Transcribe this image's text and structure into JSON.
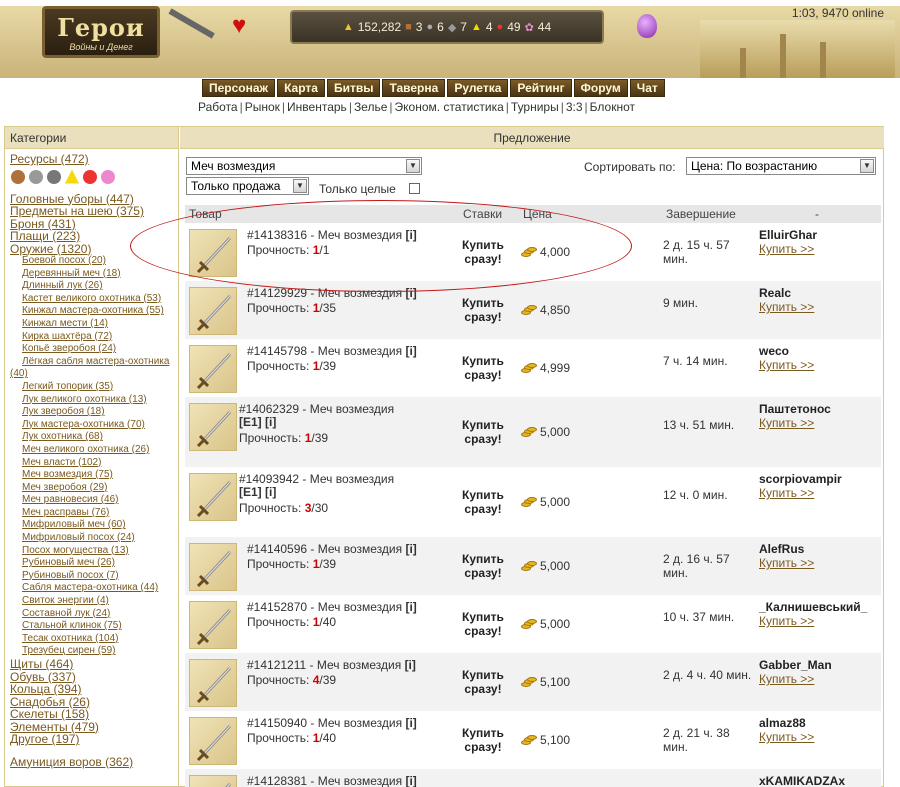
{
  "header": {
    "logo_title": "Герои",
    "logo_subtitle": "Войны и Денег",
    "time_online": "1:03, 9470 online",
    "resources": [
      {
        "icon": "gold-icon",
        "value": "152,282"
      },
      {
        "icon": "wood-icon",
        "value": "3"
      },
      {
        "icon": "ore-icon",
        "value": "6"
      },
      {
        "icon": "mercury-icon",
        "value": "7"
      },
      {
        "icon": "sulfur-icon",
        "value": "4"
      },
      {
        "icon": "crystal-icon",
        "value": "49"
      },
      {
        "icon": "gems-icon",
        "value": "44"
      }
    ],
    "nav_main": [
      "Персонаж",
      "Карта",
      "Битвы",
      "Таверна",
      "Рулетка",
      "Рейтинг",
      "Форум",
      "Чат"
    ],
    "nav_sub": [
      "Работа",
      "Рынок",
      "Инвентарь",
      "Зелье",
      "Эконом. статистика",
      "Турниры",
      "3:3",
      "Блокнот"
    ]
  },
  "left": {
    "heading": "Категории",
    "resources_link": "Ресурсы (472)",
    "categories_top": [
      "Головные уборы (447)",
      "Предметы на шею (375)",
      "Броня (431)",
      "Плащи (223)",
      "Оружие (1320)"
    ],
    "weapons": [
      "Боевой посох (20)",
      "Деревянный меч (18)",
      "Длинный лук (26)",
      "Кастет великого охотника (53)",
      "Кинжал мастера-охотника (55)",
      "Кинжал мести (14)",
      "Кирка шахтёра (72)",
      "Копьё зверобоя (24)",
      "Лёгкая сабля мастера-охотника (40)",
      "Легкий топорик (35)",
      "Лук великого охотника (13)",
      "Лук зверобоя (18)",
      "Лук мастера-охотника (70)",
      "Лук охотника (68)",
      "Меч великого охотника (26)",
      "Меч власти (102)",
      "Меч возмездия (75)",
      "Меч зверобоя (29)",
      "Меч равновесия (46)",
      "Меч расправы (76)",
      "Мифриловый меч (60)",
      "Мифриловый посох (24)",
      "Посох могущества (13)",
      "Рубиновый меч (26)",
      "Рубиновый посох (7)",
      "Сабля мастера-охотника (44)",
      "Свиток энергии (4)",
      "Составной лук (24)",
      "Стальной клинок (75)",
      "Тесак охотника (104)",
      "Трезубец сирен (59)"
    ],
    "categories_bottom": [
      "Щиты (464)",
      "Обувь (337)",
      "Кольца (394)",
      "Снадобья (26)",
      "Скелеты (158)",
      "Элементы (479)",
      "Другое (197)"
    ],
    "ammo": "Амуниция воров (362)"
  },
  "right": {
    "heading": "Предложение",
    "item_select": "Меч возмездия",
    "sale_select": "Только продажа",
    "only_whole": "Только целые",
    "sort_label": "Сортировать по:",
    "sort_select": "Цена: По возрастанию",
    "columns": {
      "item": "Товар",
      "bids": "Ставки",
      "price": "Цена",
      "ends": "Завершение",
      "seller": "-"
    },
    "buy_now": "Купить сразу!",
    "buy_link": "Купить >>",
    "lots": [
      {
        "lot": "#14138316 - Меч возмездия",
        "tag": "[i]",
        "dur_label": "Прочность:",
        "dur_cur": "1",
        "dur_max": "/1",
        "price": "4,000",
        "ends": "2 д. 15 ч. 57 мин.",
        "seller": "ElluirGhar"
      },
      {
        "lot": "#14129929 - Меч возмездия",
        "tag": "[i]",
        "dur_label": "Прочность:",
        "dur_cur": "1",
        "dur_max": "/35",
        "price": "4,850",
        "ends": "9 мин.",
        "seller": "Realc"
      },
      {
        "lot": "#14145798 - Меч возмездия",
        "tag": "[i]",
        "dur_label": "Прочность:",
        "dur_cur": "1",
        "dur_max": "/39",
        "price": "4,999",
        "ends": "7 ч. 14 мин.",
        "seller": "weco"
      },
      {
        "lot": "#14062329 - Меч возмездия",
        "tag": "[E1] [i]",
        "dur_label": "Прочность:",
        "dur_cur": "1",
        "dur_max": "/39",
        "price": "5,000",
        "ends": "13 ч. 51 мин.",
        "seller": "Паштетонос"
      },
      {
        "lot": "#14093942 - Меч возмездия",
        "tag": "[E1] [i]",
        "dur_label": "Прочность:",
        "dur_cur": "3",
        "dur_max": "/30",
        "price": "5,000",
        "ends": "12 ч. 0 мин.",
        "seller": "scorpiovampir"
      },
      {
        "lot": "#14140596 - Меч возмездия",
        "tag": "[i]",
        "dur_label": "Прочность:",
        "dur_cur": "1",
        "dur_max": "/39",
        "price": "5,000",
        "ends": "2 д. 16 ч. 57 мин.",
        "seller": "AlefRus"
      },
      {
        "lot": "#14152870 - Меч возмездия",
        "tag": "[i]",
        "dur_label": "Прочность:",
        "dur_cur": "1",
        "dur_max": "/40",
        "price": "5,000",
        "ends": "10 ч. 37 мин.",
        "seller": "_Калнишевський_"
      },
      {
        "lot": "#14121211 - Меч возмездия",
        "tag": "[i]",
        "dur_label": "Прочность:",
        "dur_cur": "4",
        "dur_max": "/39",
        "price": "5,100",
        "ends": "2 д. 4 ч. 40 мин.",
        "seller": "Gabber_Man"
      },
      {
        "lot": "#14150940 - Меч возмездия",
        "tag": "[i]",
        "dur_label": "Прочность:",
        "dur_cur": "1",
        "dur_max": "/40",
        "price": "5,100",
        "ends": "2 д. 21 ч. 38 мин.",
        "seller": "almaz88"
      },
      {
        "lot": "#14128381 - Меч возмездия",
        "tag": "[i]",
        "dur_label": "Прочность:",
        "dur_cur": "",
        "dur_max": "",
        "price": "",
        "ends": "",
        "seller": "xKAMIKADZAx"
      }
    ]
  }
}
